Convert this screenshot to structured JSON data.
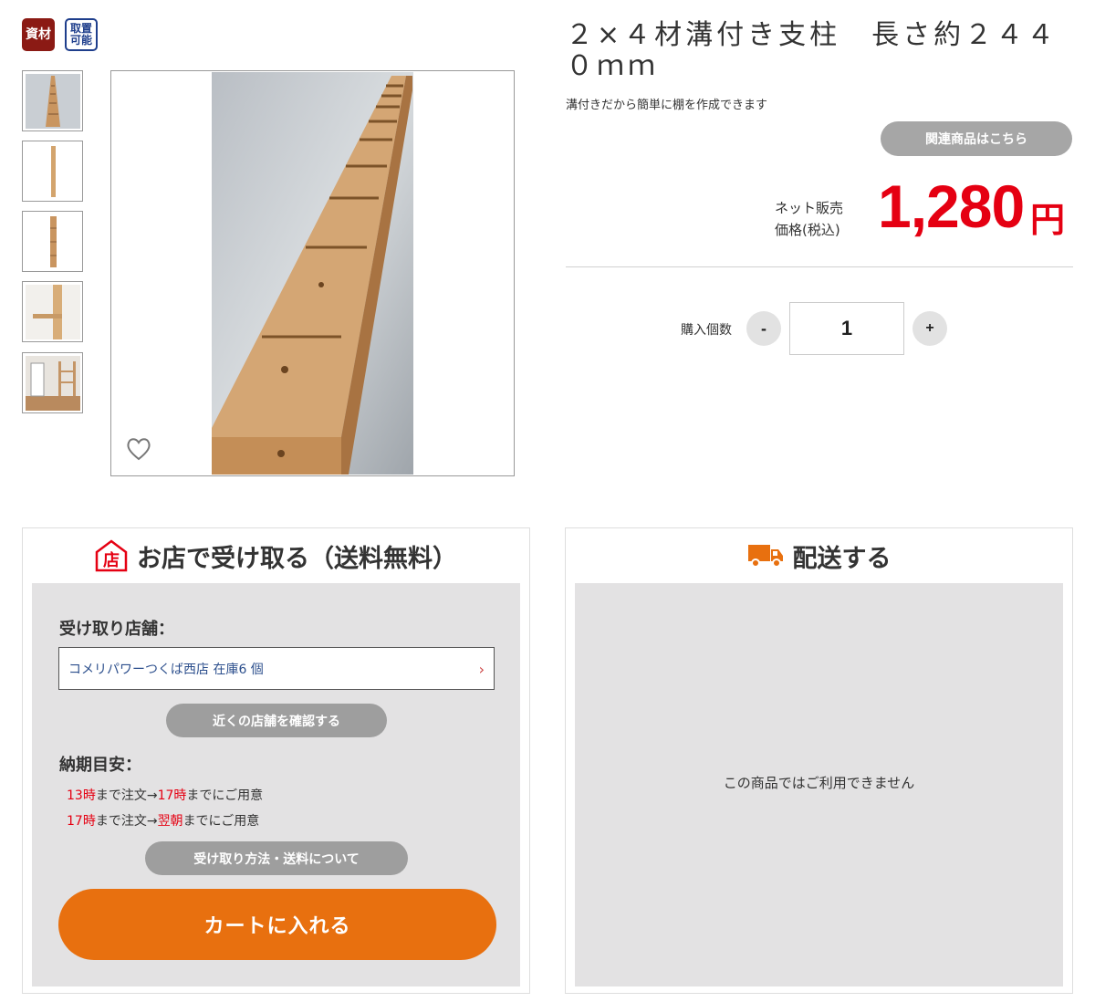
{
  "badges": {
    "material": "資材",
    "order_line1": "取置",
    "order_line2": "可能"
  },
  "thumbnails": [
    {
      "name": "thumb-1",
      "icon": "lumber-top-view"
    },
    {
      "name": "thumb-2",
      "icon": "lumber-side-view"
    },
    {
      "name": "thumb-3",
      "icon": "lumber-side-view"
    },
    {
      "name": "thumb-4",
      "icon": "lumber-installed"
    },
    {
      "name": "thumb-5",
      "icon": "room-shelf"
    }
  ],
  "product": {
    "title": "２×４材溝付き支柱　長さ約２４４０ｍｍ",
    "subtitle": "溝付きだから簡単に棚を作成できます",
    "related_label": "関連商品はこちら",
    "price_label_line1": "ネット販売",
    "price_label_line2": "価格(税込)",
    "price": "1,280",
    "price_unit": "円"
  },
  "quantity": {
    "label": "購入個数",
    "minus": "-",
    "plus": "+",
    "value": "1"
  },
  "pickup": {
    "header": "お店で受け取る（送料無料）",
    "store_label": "受け取り店舗：",
    "store_value": "コメリパワーつくば西店 在庫6 個",
    "nearby_label": "近くの店舗を確認する",
    "delivery_label": "納期目安：",
    "line1_time": "13時",
    "line1_mid": "まで注文→",
    "line1_time2": "17時",
    "line1_end": "までにご用意",
    "line2_time": "17時",
    "line2_mid": "まで注文→",
    "line2_time2": "翌朝",
    "line2_end": "までにご用意",
    "method_label": "受け取り方法・送料について",
    "cart_label": "カートに入れる"
  },
  "delivery": {
    "header": "配送する",
    "unavailable": "この商品ではご利用できません"
  },
  "colors": {
    "price_red": "#e50012",
    "cart_orange": "#e8700f",
    "badge_material": "#8b1a14",
    "badge_order": "#1e3e8c"
  }
}
